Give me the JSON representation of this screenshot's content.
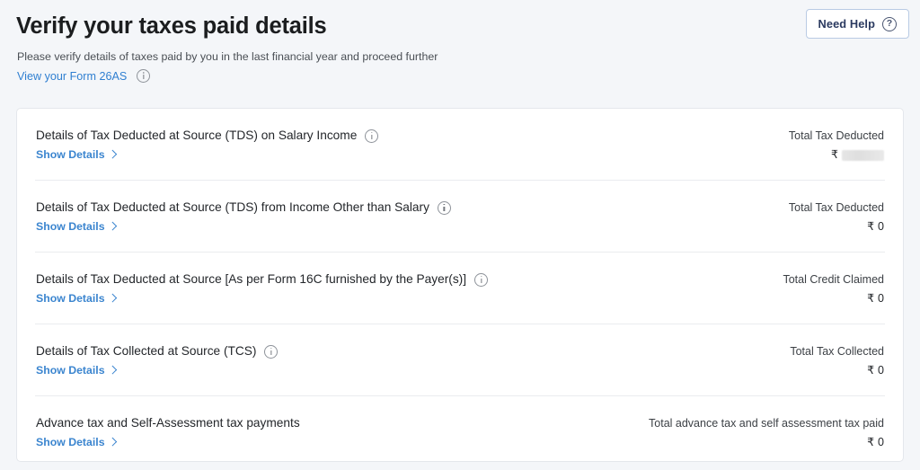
{
  "header": {
    "title": "Verify your taxes paid details",
    "subtitle": "Please verify details of taxes paid by you in the last financial year and proceed further",
    "form26as_link": "View your Form 26AS",
    "form26as_info_icon": "info-icon",
    "need_help": {
      "label": "Need Help",
      "icon": "question-mark-circle-icon"
    }
  },
  "card": {
    "show_details_label": "Show Details",
    "chevron_icon": "chevron-right-icon",
    "currency_symbol": "₹",
    "rows": [
      {
        "title": "Details of Tax Deducted at Source (TDS) on Salary Income",
        "has_info_icon": true,
        "info_icon": "info-icon",
        "amount_label": "Total Tax Deducted",
        "amount_value": "",
        "redacted": true
      },
      {
        "title": "Details of Tax Deducted at Source (TDS) from Income Other than Salary",
        "has_info_icon": true,
        "info_icon": "info-icon",
        "amount_label": "Total Tax Deducted",
        "amount_value": "0",
        "redacted": false
      },
      {
        "title": "Details of Tax Deducted at Source [As per Form 16C furnished by the Payer(s)]",
        "has_info_icon": true,
        "info_icon": "info-icon",
        "amount_label": "Total Credit Claimed",
        "amount_value": "0",
        "redacted": false
      },
      {
        "title": "Details of Tax Collected at Source (TCS)",
        "has_info_icon": true,
        "info_icon": "info-icon",
        "amount_label": "Total Tax Collected",
        "amount_value": "0",
        "redacted": false
      },
      {
        "title": "Advance tax and Self-Assessment tax payments",
        "has_info_icon": false,
        "info_icon": "",
        "amount_label": "Total advance tax and self assessment tax paid",
        "amount_value": "0",
        "redacted": false
      }
    ]
  },
  "colors": {
    "page_background": "#f4f6f9",
    "card_background": "#ffffff",
    "card_border": "#e4e7ec",
    "link_blue": "#3b85cf",
    "title_text": "#1b1d1f",
    "need_help_border": "#b9cbe4",
    "need_help_text": "#2b3a60"
  }
}
